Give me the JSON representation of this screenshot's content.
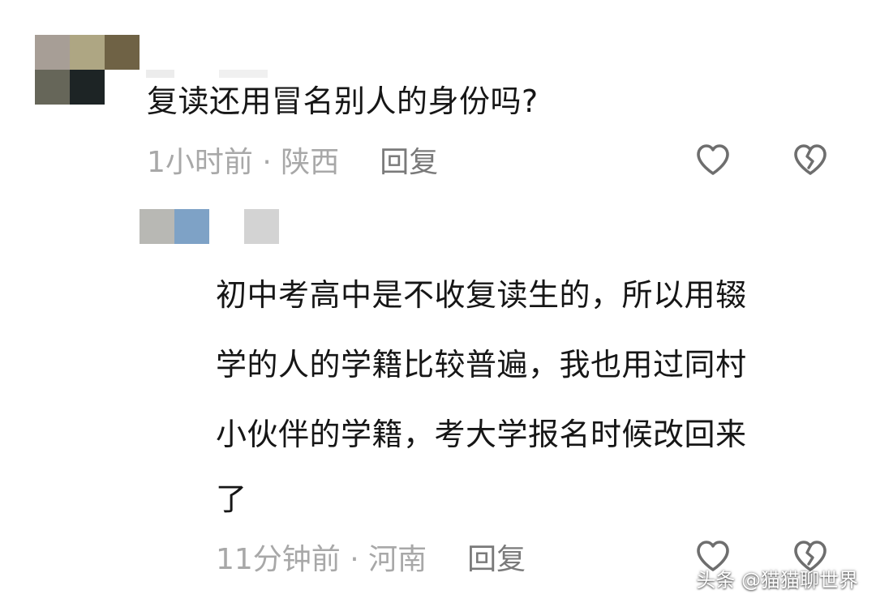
{
  "comments": [
    {
      "text": "复读还用冒名别人的身份吗?",
      "time_location": "1小时前 · 陕西",
      "reply_label": "回复",
      "like_icon": "heart-outline-icon",
      "dislike_icon": "broken-heart-icon"
    },
    {
      "lines": [
        "初中考高中是不收复读生的，所以用辍",
        "学的人的学籍比较普遍，我也用过同村",
        "小伙伴的学籍，考大学报名时候改回来",
        "了"
      ],
      "time_location": "11分钟前 · 河南",
      "reply_label": "回复",
      "like_icon": "heart-outline-icon",
      "dislike_icon": "broken-heart-icon"
    }
  ],
  "watermark": "头条 @猫猫聊世界",
  "colors": {
    "text": "#161616",
    "meta": "#a8a8a8",
    "reply": "#7a7a7a",
    "icon": "#6e6e6e"
  }
}
